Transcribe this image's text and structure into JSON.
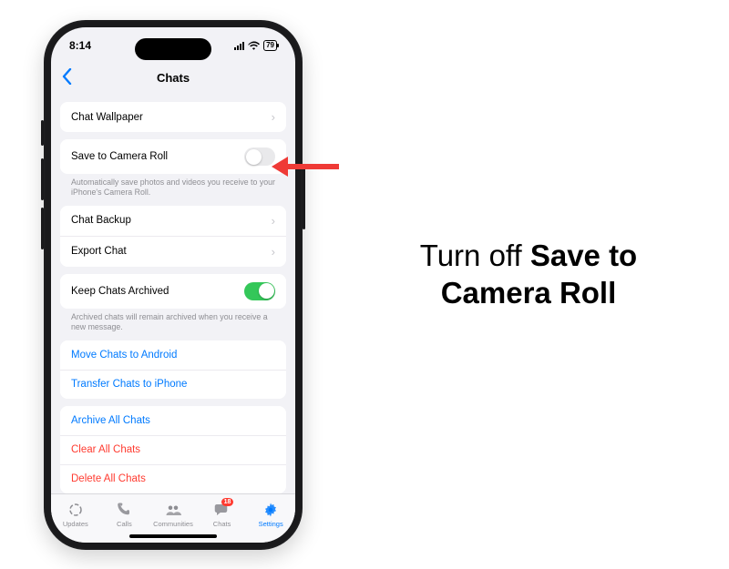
{
  "status": {
    "time": "8:14",
    "battery": "79"
  },
  "nav": {
    "title": "Chats"
  },
  "rows": {
    "wallpaper": "Chat Wallpaper",
    "saveRoll": "Save to Camera Roll",
    "saveRoll_note": "Automatically save photos and videos you receive to your iPhone's Camera Roll.",
    "backup": "Chat Backup",
    "export": "Export Chat",
    "keepArch": "Keep Chats Archived",
    "keepArch_note": "Archived chats will remain archived when you receive a new message.",
    "moveAndroid": "Move Chats to Android",
    "transferIphone": "Transfer Chats to iPhone",
    "archiveAll": "Archive All Chats",
    "clearAll": "Clear All Chats",
    "deleteAll": "Delete All Chats"
  },
  "toggles": {
    "saveRoll": false,
    "keepArch": true
  },
  "tabs": {
    "updates": "Updates",
    "calls": "Calls",
    "communities": "Communities",
    "chats": "Chats",
    "settings": "Settings",
    "chats_badge": "18"
  },
  "instruction": {
    "pre": "Turn off ",
    "bold": "Save to Camera Roll"
  }
}
